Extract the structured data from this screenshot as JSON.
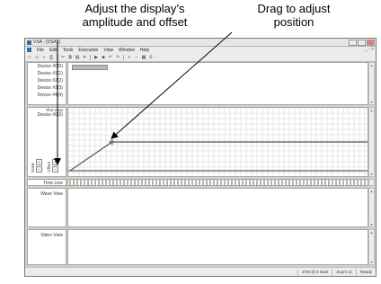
{
  "callouts": {
    "left_line1": "Adjust the display’s",
    "left_line2": "amplitude and offset",
    "right_line1": "Drag to adjust",
    "right_line2": "position"
  },
  "window": {
    "title": "VSA - [VSA1]",
    "controls": [
      "minimize",
      "maximize",
      "close"
    ]
  },
  "menu": {
    "items": [
      "File",
      "Edit",
      "Tools",
      "Execution",
      "View",
      "Window",
      "Help"
    ],
    "mdi_controls": "_ ▫ ×"
  },
  "toolbar": {
    "icons": [
      "new-icon",
      "open-icon",
      "save-icon",
      "print-icon",
      "cut-icon",
      "copy-icon",
      "paste-icon",
      "delete-icon",
      "play-icon",
      "stop-icon",
      "undo-icon",
      "redo-icon",
      "zoom-in-icon",
      "zoom-out-icon",
      "chart-icon",
      "pin-icon"
    ],
    "glyphs": [
      "□",
      "▭",
      "▪",
      "⎙",
      "✂",
      "⧉",
      "▤",
      "✕",
      "▶",
      "■",
      "↶",
      "↷",
      "+",
      "−",
      "▦",
      "⚲"
    ]
  },
  "devices": [
    "Device #0(0)",
    "Device #1(1)",
    "Device #2(2)",
    "Device #3(3)",
    "Device #4(4)"
  ],
  "plot_view": {
    "label": "Plot View",
    "device": "Device #0(0)",
    "scale_label": "Scale",
    "offset_label": "Offset",
    "plus": "+",
    "minus": "−"
  },
  "plot_data": {
    "segments": [
      [
        0,
        0.08
      ],
      [
        0.14,
        0.5
      ],
      [
        1,
        0.5
      ]
    ],
    "baseline_level": 0.08,
    "handle": [
      0.14,
      0.5
    ],
    "colors": {
      "line": "#555555",
      "grid": "#cfcfcf",
      "handle": "#7a7a7a"
    }
  },
  "timeline": {
    "label": "Time Line"
  },
  "wave_view": {
    "label": "Wave View"
  },
  "video_view": {
    "label": "Video View"
  },
  "hscroll": {
    "left": "◂",
    "right": "▸",
    "thumb": "▸"
  },
  "status": {
    "memory": "47M @ 0 track",
    "zoom": "Zoom x1",
    "state": "Ready"
  }
}
